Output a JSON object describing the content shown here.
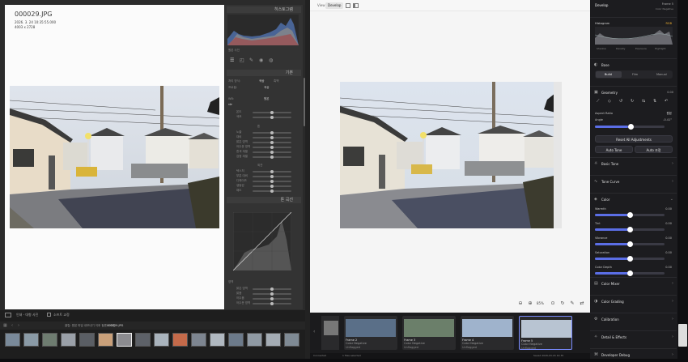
{
  "left_app": {
    "overlay": {
      "filename": "000029.JPG",
      "datetime": "2026. 3. 24 10:35:55.000",
      "dimensions": "4003 x 2728"
    },
    "panel": {
      "histogram_title": "히스토그램",
      "original_photo": "원본 사진",
      "basic_header": "기본",
      "treatment_label": "처리 방식:",
      "treatment_color": "색상",
      "treatment_bw": "흑백",
      "profile_label": "프로필:",
      "profile_value": "색상",
      "wb_label": "WB:",
      "wb_value": "원본",
      "temp_label": "온도",
      "tint_label": "색조",
      "tone_label": "톤",
      "auto_label": "자동",
      "exposure_label": "노출",
      "contrast_label": "대비",
      "highlights_label": "밝은 영역",
      "shadows_label": "어두운 영역",
      "whites_label": "흰색 계열",
      "blacks_label": "검정 계열",
      "presence_label": "외관",
      "texture_label": "텍스처",
      "clarity_label": "부분 대비",
      "dehaze_label": "디헤이즈",
      "vibrance_label": "생동감",
      "saturation_label": "채도",
      "tone_curve_header": "톤 곡선",
      "region_label": "영역",
      "r_highlights": "밝은 영역",
      "r_lights": "밝음",
      "r_darks": "어두움",
      "r_shadows": "어두운 영역",
      "prev_button": "이전 설정",
      "reset_button": "재설정"
    },
    "bottom": {
      "toolbar_text": "소프트 교정",
      "left_caption": "인쇄 - 대형 사진",
      "info_text": "클립: 원본 파일 내보내기 이후 필름 스트립",
      "file_label": "000029.JPG"
    }
  },
  "right_app": {
    "tabs": [
      "View",
      "Develop"
    ],
    "active_tab": "Develop",
    "zoom": "85%",
    "frames": [
      {
        "title": "Frame 2",
        "subtitle": "Color Negative",
        "tag": "Unflagged"
      },
      {
        "title": "Frame 3",
        "subtitle": "Color Negative",
        "tag": "Unflagged"
      },
      {
        "title": "Frame 4",
        "subtitle": "Color Negative",
        "tag": "Unflagged"
      },
      {
        "title": "Frame 5",
        "subtitle": "Color Negative",
        "tag": "Unflagged"
      }
    ],
    "status_left": "Connected",
    "status_mid": "1 files selected",
    "status_right": "Saved 2026-03-24 10:35"
  },
  "develop_panel": {
    "title": "Develop",
    "frame_title": "Frame 5",
    "frame_info": "Color Negative",
    "histogram_label": "Histogram",
    "histogram_mode": "RGB",
    "hist_zones": [
      "Shadow",
      "Density",
      "Exposure",
      "Highlight"
    ],
    "base_label": "Base",
    "base_tabs": [
      "Build",
      "Film",
      "Manual"
    ],
    "geometry_label": "Geometry",
    "geometry_value": "0.00",
    "aspect_label": "Aspect Ratio",
    "aspect_value": "원본",
    "angle_label": "Angle",
    "angle_value": "-0.41°",
    "reset_all": "Reset All Adjustments",
    "auto_tone": "Auto Tone",
    "auto_all": "Auto 조정",
    "sections": [
      "Basic Tone",
      "Tone Curve"
    ],
    "color_label": "Color",
    "color_sliders": [
      {
        "label": "Warmth",
        "value": "0.00",
        "pct": 0.5
      },
      {
        "label": "Tint",
        "value": "0.00",
        "pct": 0.5
      },
      {
        "label": "Vibrance",
        "value": "0.00",
        "pct": 0.5
      },
      {
        "label": "Saturation",
        "value": "0.00",
        "pct": 0.5
      },
      {
        "label": "Color Depth",
        "value": "0.00",
        "pct": 0.5
      }
    ],
    "lower_sections": [
      "Color Mixer",
      "Color Grading",
      "Calibration",
      "Detail & Effects",
      "Developer Debug"
    ]
  },
  "colors": {
    "accent": "#5b6ee6",
    "left_bg": "#2b2b2b",
    "right_bg": "#f5f5f5",
    "panel_dark": "#1c1c1f"
  }
}
